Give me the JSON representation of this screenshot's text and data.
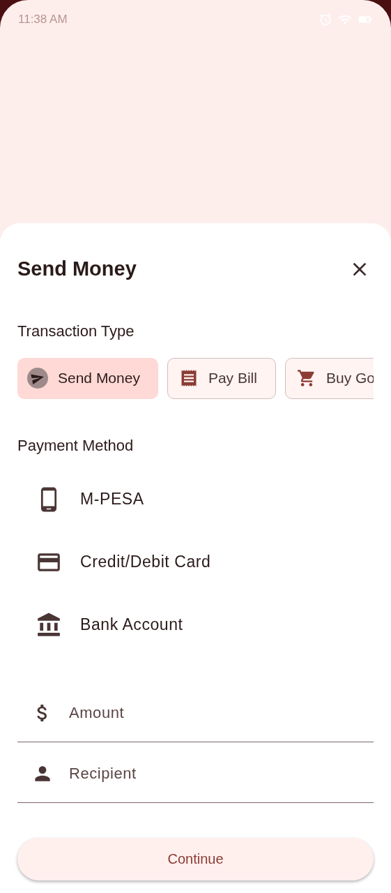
{
  "status_bar": {
    "time": "11:38 AM"
  },
  "sheet": {
    "title": "Send Money"
  },
  "transaction_type": {
    "heading": "Transaction Type",
    "options": [
      {
        "label": "Send Money",
        "kind": "send",
        "selected": true
      },
      {
        "label": "Pay Bill",
        "kind": "bill",
        "selected": false
      },
      {
        "label": "Buy Go",
        "kind": "goods",
        "selected": false
      }
    ]
  },
  "payment_method": {
    "heading": "Payment Method",
    "items": [
      {
        "label": "M-PESA",
        "kind": "phone"
      },
      {
        "label": "Credit/Debit Card",
        "kind": "card"
      },
      {
        "label": "Bank Account",
        "kind": "bank"
      }
    ]
  },
  "fields": [
    {
      "placeholder": "Amount",
      "kind": "money"
    },
    {
      "placeholder": "Recipient",
      "kind": "person"
    }
  ],
  "continue_button": "Continue"
}
